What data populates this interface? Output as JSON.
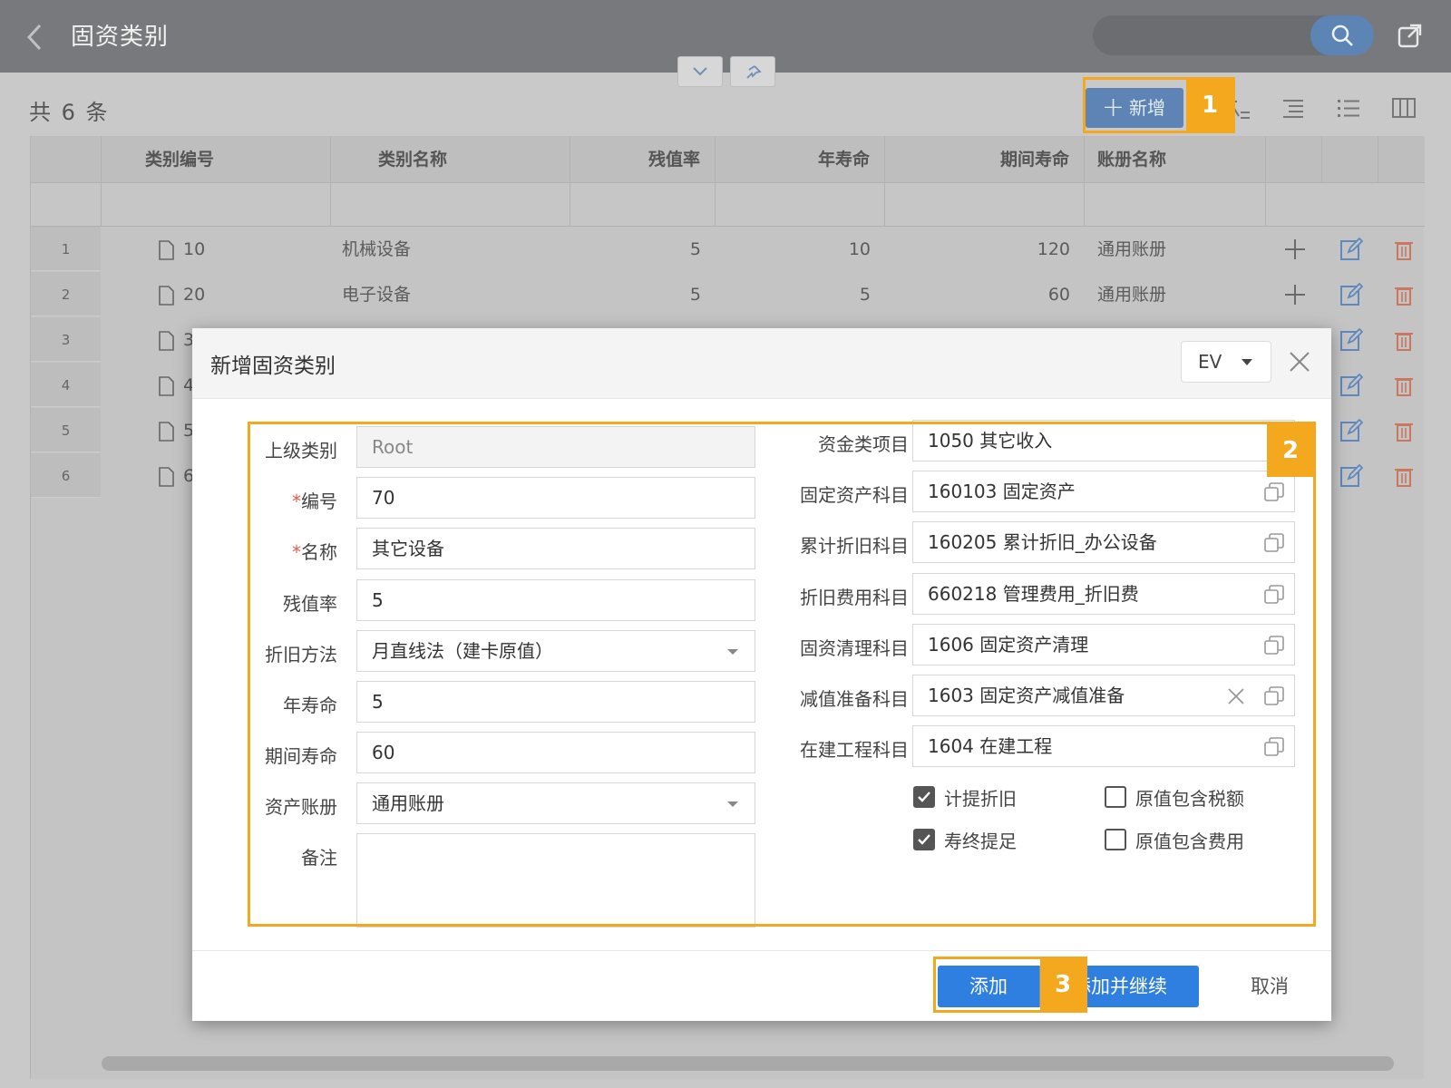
{
  "app": {
    "title": "固资类别"
  },
  "list": {
    "count_text": "共 6 条",
    "add_button": "新增",
    "columns": [
      "类别编号",
      "类别名称",
      "残值率",
      "年寿命",
      "期间寿命",
      "账册名称"
    ],
    "rows": [
      {
        "num": "1",
        "code": "10",
        "name": "机械设备",
        "residual": "5",
        "life": "10",
        "period": "120",
        "book": "通用账册"
      },
      {
        "num": "2",
        "code": "20",
        "name": "电子设备",
        "residual": "5",
        "life": "5",
        "period": "60",
        "book": "通用账册"
      },
      {
        "num": "3",
        "code": "3"
      },
      {
        "num": "4",
        "code": "4"
      },
      {
        "num": "5",
        "code": "5"
      },
      {
        "num": "6",
        "code": "6"
      }
    ]
  },
  "dialog": {
    "title": "新增固资类别",
    "lang": "EV",
    "left": {
      "parent": {
        "label": "上级类别",
        "value": "Root"
      },
      "code": {
        "label": "编号",
        "value": "70"
      },
      "name": {
        "label": "名称",
        "value": "其它设备"
      },
      "residual": {
        "label": "残值率",
        "value": "5"
      },
      "method": {
        "label": "折旧方法",
        "value": "月直线法（建卡原值）"
      },
      "life": {
        "label": "年寿命",
        "value": "5"
      },
      "period": {
        "label": "期间寿命",
        "value": "60"
      },
      "book": {
        "label": "资产账册",
        "value": "通用账册"
      },
      "remark": {
        "label": "备注",
        "value": ""
      }
    },
    "right": {
      "fund": {
        "label": "资金类项目",
        "value": "1050 其它收入"
      },
      "fixed": {
        "label": "固定资产科目",
        "value": "160103 固定资产"
      },
      "accum": {
        "label": "累计折旧科目",
        "value": "160205 累计折旧_办公设备"
      },
      "expense": {
        "label": "折旧费用科目",
        "value": "660218 管理费用_折旧费"
      },
      "clear": {
        "label": "固资清理科目",
        "value": "1606 固定资产清理"
      },
      "impair": {
        "label": "减值准备科目",
        "value": "1603 固定资产减值准备"
      },
      "cip": {
        "label": "在建工程科目",
        "value": "1604 在建工程"
      }
    },
    "checkboxes": {
      "depreciate": {
        "label": "计提折旧",
        "checked": true
      },
      "tax": {
        "label": "原值包含税额",
        "checked": false
      },
      "full_life": {
        "label": "寿终提足",
        "checked": true
      },
      "fee": {
        "label": "原值包含费用",
        "checked": false
      }
    },
    "buttons": {
      "add": "添加",
      "add_continue": "添加并继续",
      "cancel": "取消"
    }
  },
  "annotations": {
    "step1": "1",
    "step2": "2",
    "step3": "3"
  },
  "colors": {
    "highlight": "#f4a81d",
    "primary": "#2f7fe0",
    "topbar": "#77797c"
  }
}
